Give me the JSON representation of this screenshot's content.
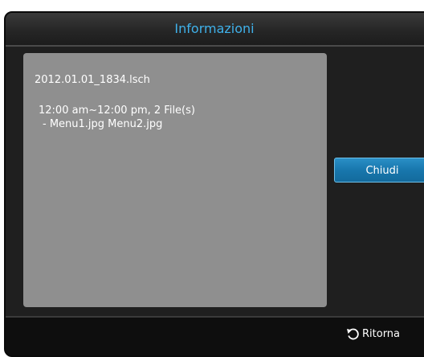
{
  "dialog": {
    "title": "Informazioni",
    "title_color": "#3fb1ea"
  },
  "info": {
    "file_name": "2012.01.01_1834.lsch",
    "detail_line_1": "12:00 am~12:00 pm, 2 File(s)",
    "detail_line_2": "- Menu1.jpg Menu2.jpg"
  },
  "buttons": {
    "close_label": "Chiudi"
  },
  "footer": {
    "return_label": "Ritorna",
    "return_icon": "return-arrow-icon"
  }
}
